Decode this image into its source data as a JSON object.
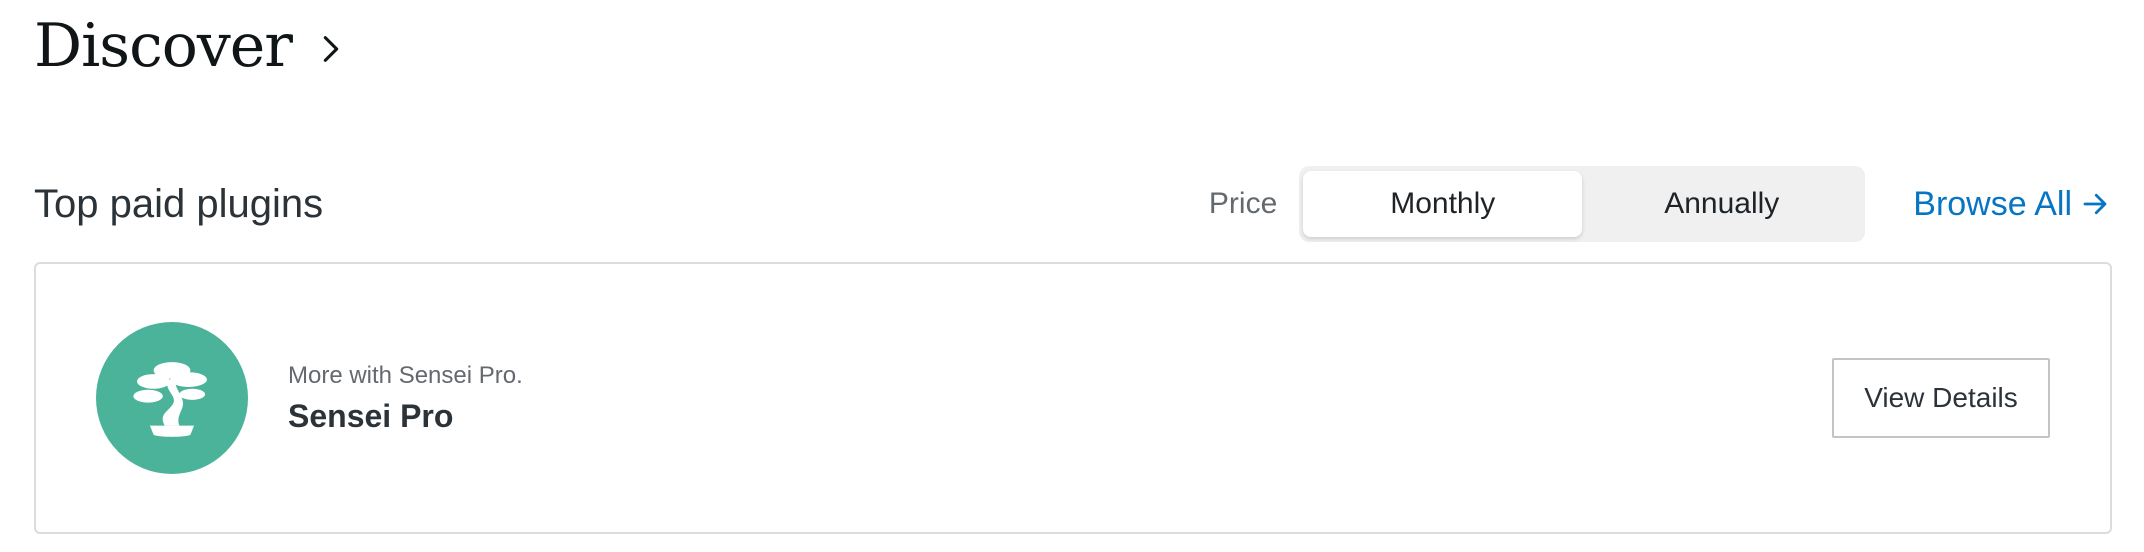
{
  "header": {
    "title": "Discover",
    "chevron_icon": "chevron-right-icon"
  },
  "section": {
    "title": "Top paid plugins",
    "price_label": "Price",
    "toggle": {
      "options": [
        "Monthly",
        "Annually"
      ],
      "selected": "Monthly"
    },
    "browse_all": "Browse All",
    "browse_all_icon": "arrow-right-icon",
    "link_color": "#0675c4"
  },
  "plugins": [
    {
      "subtitle": "More with Sensei Pro.",
      "name": "Sensei Pro",
      "icon": "bonsai-tree-icon",
      "icon_bg": "#4ab39a",
      "button": "View Details"
    }
  ]
}
